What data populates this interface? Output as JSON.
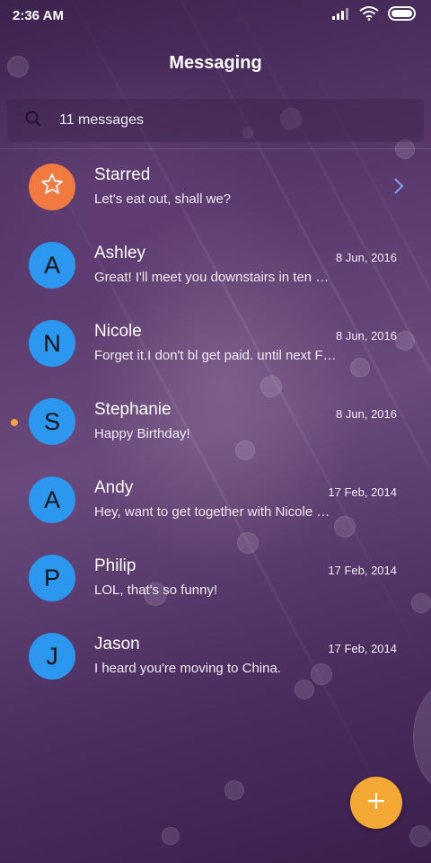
{
  "status_bar": {
    "time": "2:36 AM",
    "icons": [
      "signal-icon",
      "wifi-icon",
      "battery-icon"
    ]
  },
  "header": {
    "title": "Messaging"
  },
  "search": {
    "icon": "search-icon",
    "text": "11 messages"
  },
  "colors": {
    "avatar": "#2b97ee",
    "starred_avatar": "#f07a3f",
    "fab": "#f5a935",
    "unread_dot": "#f2a43b",
    "chevron": "#7ea4e8"
  },
  "conversations": [
    {
      "initial": "",
      "icon": "star-icon",
      "name": "Starred",
      "preview": "Let's eat out, shall we?",
      "date": "",
      "starred": true,
      "unread": false
    },
    {
      "initial": "A",
      "name": "Ashley",
      "preview": "Great! I'll meet you downstairs in ten …",
      "date": "8 Jun, 2016",
      "starred": false,
      "unread": false
    },
    {
      "initial": "N",
      "name": "Nicole",
      "preview": "Forget it.I don't bl get paid. until next F…",
      "date": "8 Jun, 2016",
      "starred": false,
      "unread": false
    },
    {
      "initial": "S",
      "name": "Stephanie",
      "preview": "Happy Birthday!",
      "date": "8 Jun, 2016",
      "starred": false,
      "unread": true
    },
    {
      "initial": "A",
      "name": "Andy",
      "preview": "Hey, want to get together with Nicole …",
      "date": "17 Feb, 2014",
      "starred": false,
      "unread": false
    },
    {
      "initial": "P",
      "name": "Philip",
      "preview": "LOL, that's so funny!",
      "date": "17 Feb, 2014",
      "starred": false,
      "unread": false
    },
    {
      "initial": "J",
      "name": "Jason",
      "preview": "I heard you're moving to China.",
      "date": "17 Feb, 2014",
      "starred": false,
      "unread": false
    }
  ],
  "fab": {
    "icon": "plus-icon"
  }
}
